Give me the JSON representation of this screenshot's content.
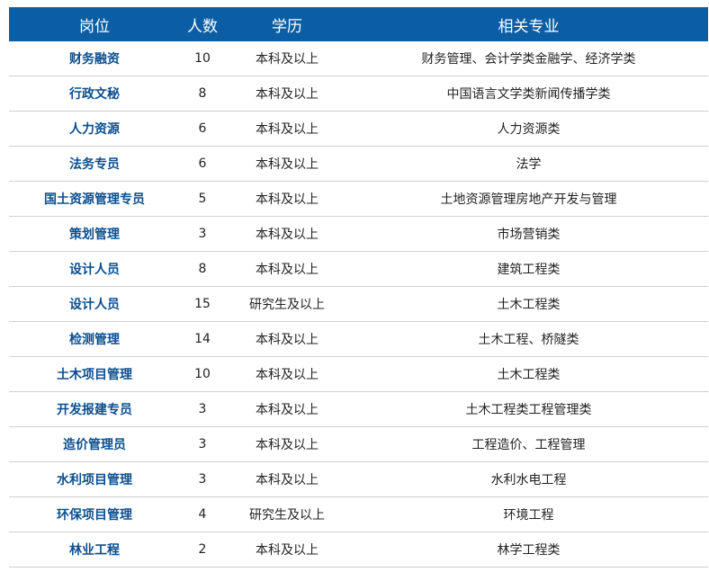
{
  "header": {
    "position": "岗位",
    "count": "人数",
    "education": "学历",
    "major": "相关专业"
  },
  "rows": [
    {
      "position": "财务融资",
      "count": "10",
      "education": "本科及以上",
      "major": "财务管理、会计学类金融学、经济学类"
    },
    {
      "position": "行政文秘",
      "count": "8",
      "education": "本科及以上",
      "major": "中国语言文学类新闻传播学类"
    },
    {
      "position": "人力资源",
      "count": "6",
      "education": "本科及以上",
      "major": "人力资源类"
    },
    {
      "position": "法务专员",
      "count": "6",
      "education": "本科及以上",
      "major": "法学"
    },
    {
      "position": "国土资源管理专员",
      "count": "5",
      "education": "本科及以上",
      "major": "土地资源管理房地产开发与管理"
    },
    {
      "position": "策划管理",
      "count": "3",
      "education": "本科及以上",
      "major": "市场营销类"
    },
    {
      "position": "设计人员",
      "count": "8",
      "education": "本科及以上",
      "major": "建筑工程类"
    },
    {
      "position": "设计人员",
      "count": "15",
      "education": "研究生及以上",
      "major": "土木工程类"
    },
    {
      "position": "检测管理",
      "count": "14",
      "education": "本科及以上",
      "major": "土木工程、桥隧类"
    },
    {
      "position": "土木项目管理",
      "count": "10",
      "education": "本科及以上",
      "major": "土木工程类"
    },
    {
      "position": "开发报建专员",
      "count": "3",
      "education": "本科及以上",
      "major": "土木工程类工程管理类"
    },
    {
      "position": "造价管理员",
      "count": "3",
      "education": "本科及以上",
      "major": "工程造价、工程管理"
    },
    {
      "position": "水利项目管理",
      "count": "3",
      "education": "本科及以上",
      "major": "水利水电工程"
    },
    {
      "position": "环保项目管理",
      "count": "4",
      "education": "研究生及以上",
      "major": "环境工程"
    },
    {
      "position": "林业工程",
      "count": "2",
      "education": "本科及以上",
      "major": "林学工程类"
    }
  ]
}
